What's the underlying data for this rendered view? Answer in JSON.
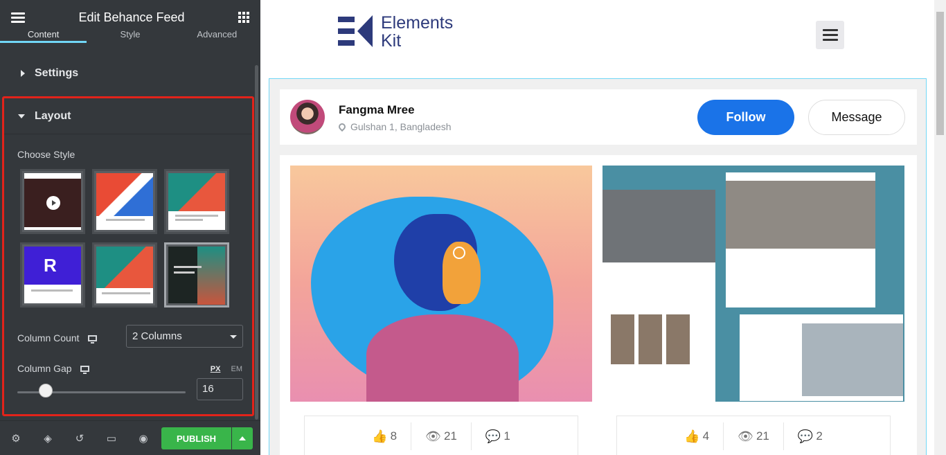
{
  "editor": {
    "title": "Edit Behance Feed",
    "tabs": [
      "Content",
      "Style",
      "Advanced"
    ],
    "settings_label": "Settings",
    "layout_label": "Layout",
    "choose_style_label": "Choose Style",
    "column_count_label": "Column Count",
    "column_count_value": "2 Columns",
    "column_gap_label": "Column Gap",
    "units": [
      "PX",
      "EM"
    ],
    "column_gap_value": "16",
    "publish_label": "PUBLISH"
  },
  "site": {
    "logo_line1": "Elements",
    "logo_line2": "Kit"
  },
  "profile": {
    "name": "Fangma Mree",
    "location": "Gulshan 1, Bangladesh",
    "follow_label": "Follow",
    "message_label": "Message"
  },
  "cards": [
    {
      "likes": "8",
      "views": "21",
      "comments": "1"
    },
    {
      "likes": "4",
      "views": "21",
      "comments": "2"
    }
  ],
  "colors": {
    "panel_bg": "#34383c",
    "highlight": "#e2231a",
    "publish": "#39b54a",
    "follow": "#1a73e8",
    "logo": "#2d3a7b"
  }
}
